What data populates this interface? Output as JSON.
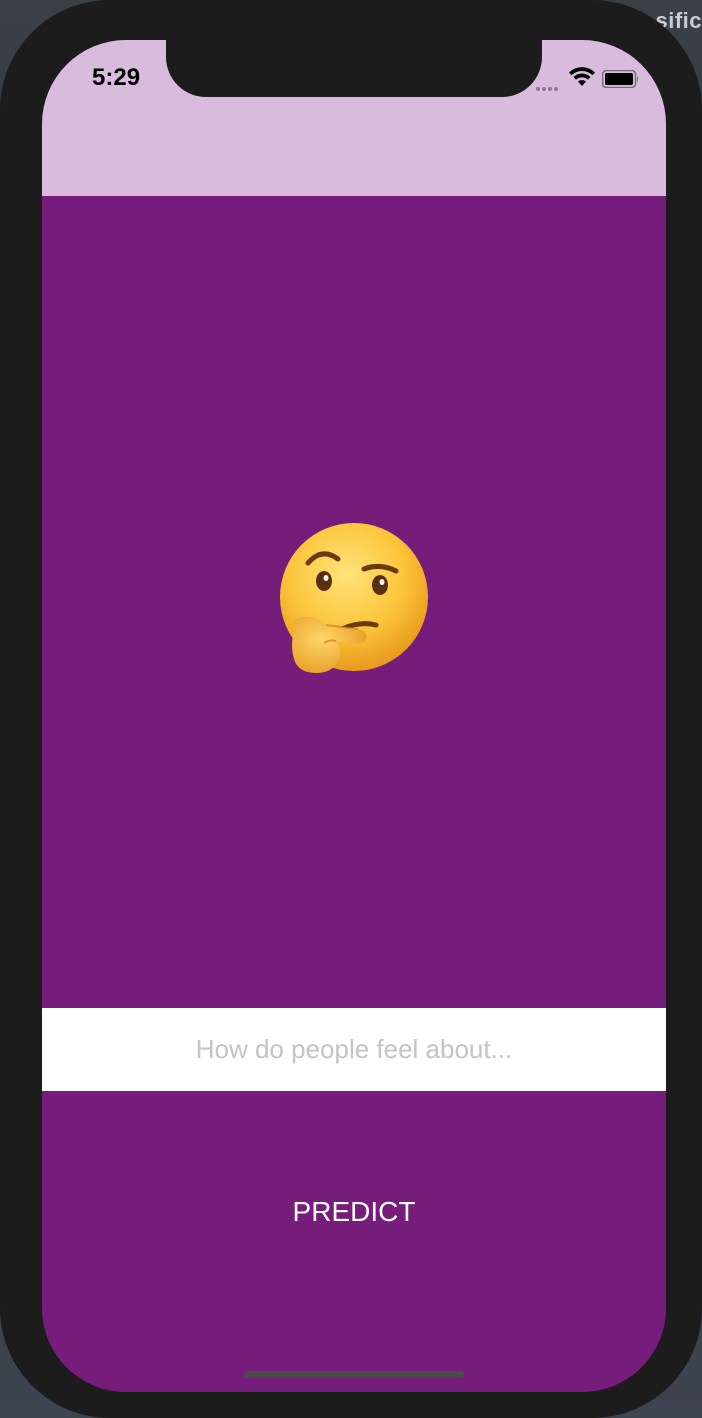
{
  "background": {
    "window_title_fragment": "sific"
  },
  "status_bar": {
    "time": "5:29",
    "icons": [
      "signal-dots-icon",
      "wifi-icon",
      "battery-icon"
    ]
  },
  "main": {
    "emoji_icon": "thinking-face-icon",
    "emoji_char": "🤔"
  },
  "input": {
    "placeholder": "How do people feel about...",
    "value": ""
  },
  "actions": {
    "predict_label": "PREDICT"
  },
  "colors": {
    "nav_bar": "#d9bcdd",
    "primary_purple": "#761c7b",
    "input_bg": "#ffffff",
    "placeholder": "#c3c3c8",
    "button_text": "#ffffff",
    "device_frame": "#1c1c1c"
  }
}
